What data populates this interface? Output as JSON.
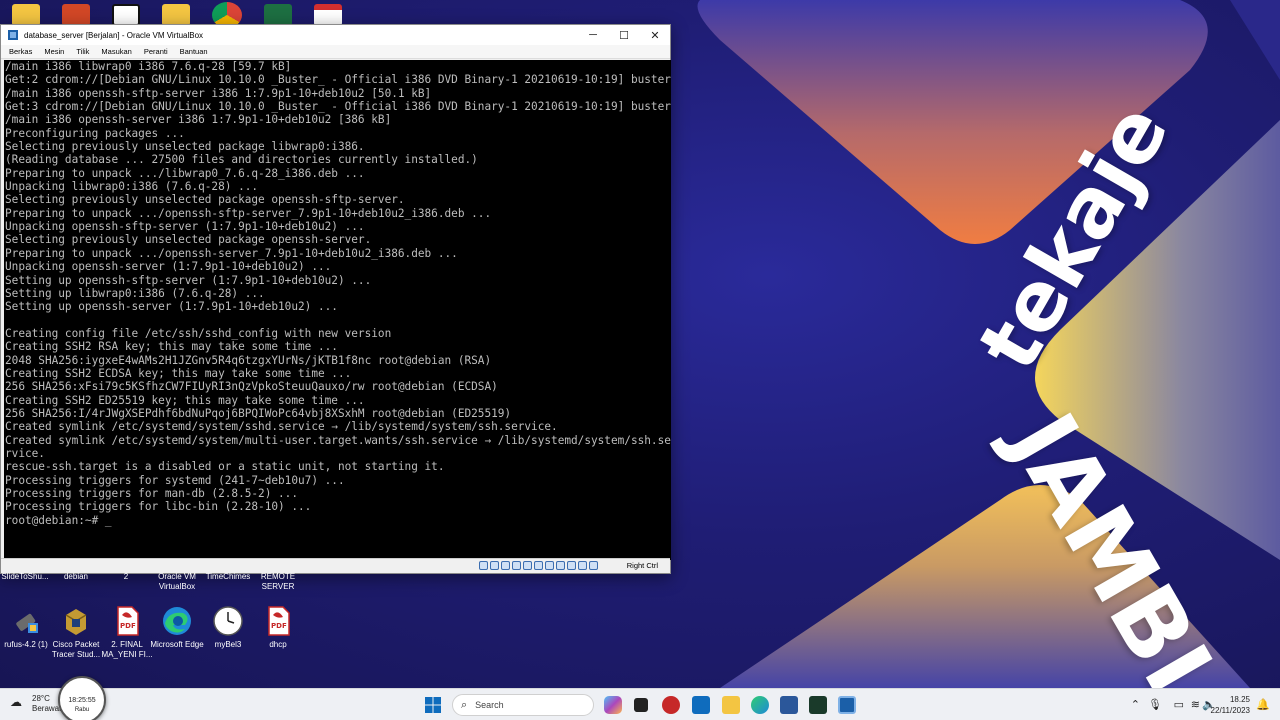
{
  "window": {
    "title": "database_server [Berjalan] - Oracle VM VirtualBox",
    "menu": [
      "Berkas",
      "Mesin",
      "Tilik",
      "Masukan",
      "Peranti",
      "Bantuan"
    ],
    "status_host_key": "Right Ctrl"
  },
  "terminal_lines": [
    "/main i386 libwrap0 i386 7.6.q-28 [59.7 kB]",
    "Get:2 cdrom://[Debian GNU/Linux 10.10.0 _Buster_ - Official i386 DVD Binary-1 20210619-10:19] buster",
    "/main i386 openssh-sftp-server i386 1:7.9p1-10+deb10u2 [50.1 kB]",
    "Get:3 cdrom://[Debian GNU/Linux 10.10.0 _Buster_ - Official i386 DVD Binary-1 20210619-10:19] buster",
    "/main i386 openssh-server i386 1:7.9p1-10+deb10u2 [386 kB]",
    "Preconfiguring packages ...",
    "Selecting previously unselected package libwrap0:i386.",
    "(Reading database ... 27500 files and directories currently installed.)",
    "Preparing to unpack .../libwrap0_7.6.q-28_i386.deb ...",
    "Unpacking libwrap0:i386 (7.6.q-28) ...",
    "Selecting previously unselected package openssh-sftp-server.",
    "Preparing to unpack .../openssh-sftp-server_7.9p1-10+deb10u2_i386.deb ...",
    "Unpacking openssh-sftp-server (1:7.9p1-10+deb10u2) ...",
    "Selecting previously unselected package openssh-server.",
    "Preparing to unpack .../openssh-server_7.9p1-10+deb10u2_i386.deb ...",
    "Unpacking openssh-server (1:7.9p1-10+deb10u2) ...",
    "Setting up openssh-sftp-server (1:7.9p1-10+deb10u2) ...",
    "Setting up libwrap0:i386 (7.6.q-28) ...",
    "Setting up openssh-server (1:7.9p1-10+deb10u2) ...",
    "",
    "Creating config file /etc/ssh/sshd_config with new version",
    "Creating SSH2 RSA key; this may take some time ...",
    "2048 SHA256:iygxeE4wAMs2H1JZGnv5R4q6tzgxYUrNs/jKTB1f8nc root@debian (RSA)",
    "Creating SSH2 ECDSA key; this may take some time ...",
    "256 SHA256:xFsi79c5KSfhzCW7FIUyRI3nQzVpkoSteuuQauxo/rw root@debian (ECDSA)",
    "Creating SSH2 ED25519 key; this may take some time ...",
    "256 SHA256:I/4rJWgXSEPdhf6bdNuPqoj6BPQIWoPc64vbj8XSxhM root@debian (ED25519)",
    "Created symlink /etc/systemd/system/sshd.service → /lib/systemd/system/ssh.service.",
    "Created symlink /etc/systemd/system/multi-user.target.wants/ssh.service → /lib/systemd/system/ssh.se",
    "rvice.",
    "rescue-ssh.target is a disabled or a static unit, not starting it.",
    "Processing triggers for systemd (241-7~deb10u7) ...",
    "Processing triggers for man-db (2.8.5-2) ...",
    "Processing triggers for libc-bin (2.28-10) ...",
    "root@debian:~# _"
  ],
  "desktop_labels_row1": [
    "SlideToShu...",
    "debian",
    "2",
    "Oracle VM VirtualBox",
    "TimeChimes",
    "REMOTE SERVER"
  ],
  "desktop_icons_row2": [
    "rufus-4.2 (1)",
    "Cisco Packet Tracer Stud...",
    "2. FINAL MA_YENI FI...",
    "Microsoft Edge",
    "myBel3",
    "dhcp"
  ],
  "brand": {
    "line1": "tekaje",
    "line2": "JAMBI"
  },
  "taskbar": {
    "weather_temp": "28°C",
    "weather_desc": "Berawan",
    "search_placeholder": "Search",
    "tray_time": "18.25",
    "tray_date": "22/11/2023"
  },
  "clock_widget": {
    "time": "18:25:55",
    "day": "Rabu"
  },
  "colors": {
    "terminal_bg": "#000000",
    "terminal_fg": "#bdbdbd",
    "wallpaper_blue": "#211f6e",
    "wallpaper_orange": "#ef7f45",
    "wallpaper_yellow": "#f1d25b"
  }
}
